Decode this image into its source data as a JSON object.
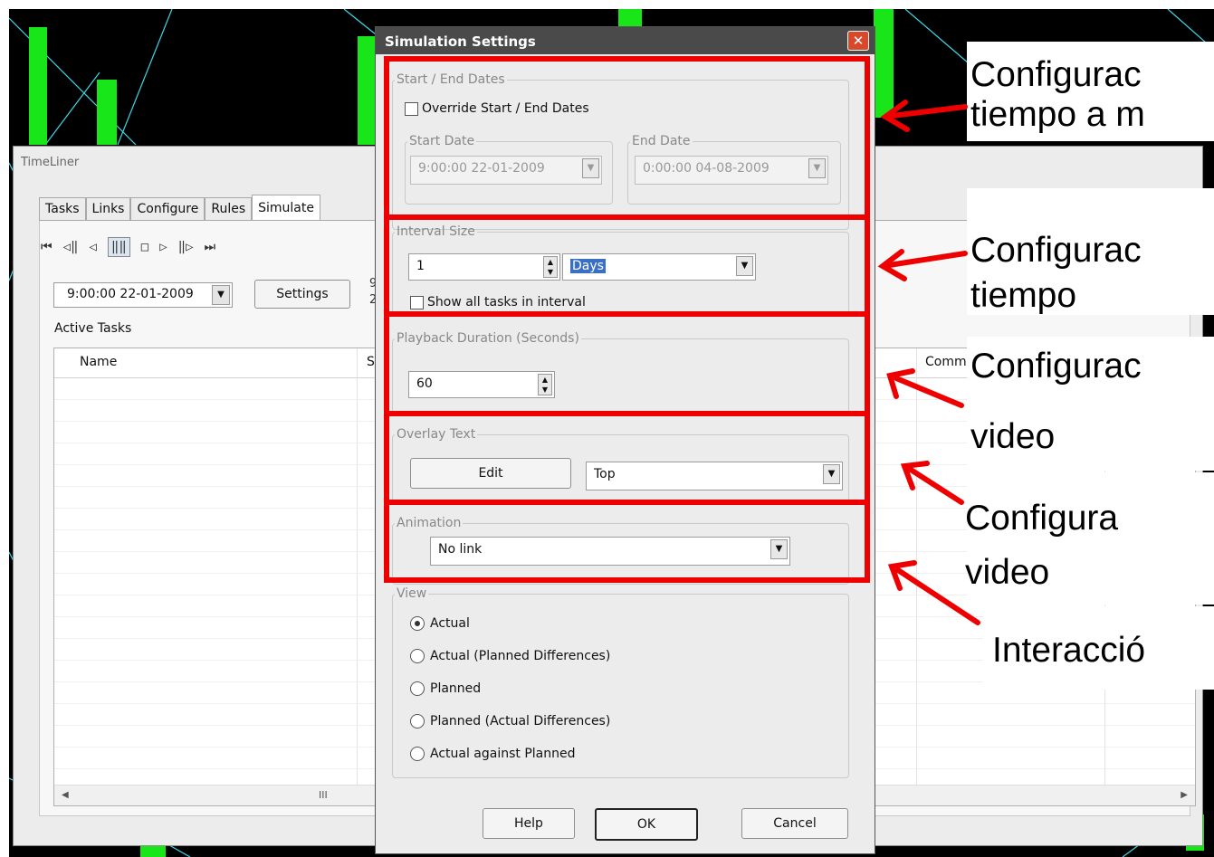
{
  "timeliner": {
    "title": "TimeLiner",
    "tabs": [
      "Tasks",
      "Links",
      "Configure",
      "Rules",
      "Simulate"
    ],
    "selected_tab": "Simulate",
    "playback_glyphs": {
      "start": "⏮",
      "step_back": "◁‖",
      "back": "◁",
      "pause": "‖‖",
      "stop": "□",
      "play": "▷",
      "step_forward": "‖▷",
      "end": "⏭"
    },
    "current_date": "9:00:00 22-01-2009",
    "settings_label": "Settings",
    "side_text_1": "9",
    "side_text_2": "2",
    "active_tasks_label": "Active Tasks",
    "columns": [
      "Name",
      "Sta",
      "Comme"
    ],
    "hscroll_thumb": "III"
  },
  "dialog": {
    "title": "Simulation Settings",
    "close_glyph": "✕",
    "start_end": {
      "legend": "Start / End Dates",
      "override_label": "Override Start / End Dates",
      "override_checked": false,
      "start_legend": "Start Date",
      "start_value": "9:00:00 22-01-2009",
      "end_legend": "End Date",
      "end_value": "0:00:00 04-08-2009"
    },
    "interval": {
      "legend": "Interval Size",
      "value": "1",
      "unit": "Days",
      "show_all_label": "Show all tasks in interval",
      "show_all_checked": false
    },
    "playback": {
      "legend": "Playback Duration (Seconds)",
      "value": "60"
    },
    "overlay": {
      "legend": "Overlay Text",
      "edit_label": "Edit",
      "position": "Top"
    },
    "animation": {
      "legend": "Animation",
      "value": "No link"
    },
    "view": {
      "legend": "View",
      "options": [
        "Actual",
        "Actual (Planned Differences)",
        "Planned",
        "Planned (Actual Differences)",
        "Actual against Planned"
      ],
      "selected": "Actual"
    },
    "buttons": {
      "help": "Help",
      "ok": "OK",
      "cancel": "Cancel"
    }
  },
  "annotations": {
    "a1_line1": "Configurac",
    "a1_line2": "tiempo a m",
    "a2_line1": "Configurac",
    "a2_line2": "tiempo",
    "a3_line1": "Configurac",
    "a3_line2": "video",
    "a4_line1": "Configura",
    "a4_line2": "video",
    "a5_line1": "Interacció"
  },
  "colors": {
    "highlight": "#ee0000",
    "background": "#000000",
    "model_green": "#19e619",
    "wire_cyan": "#3fd7e6"
  }
}
